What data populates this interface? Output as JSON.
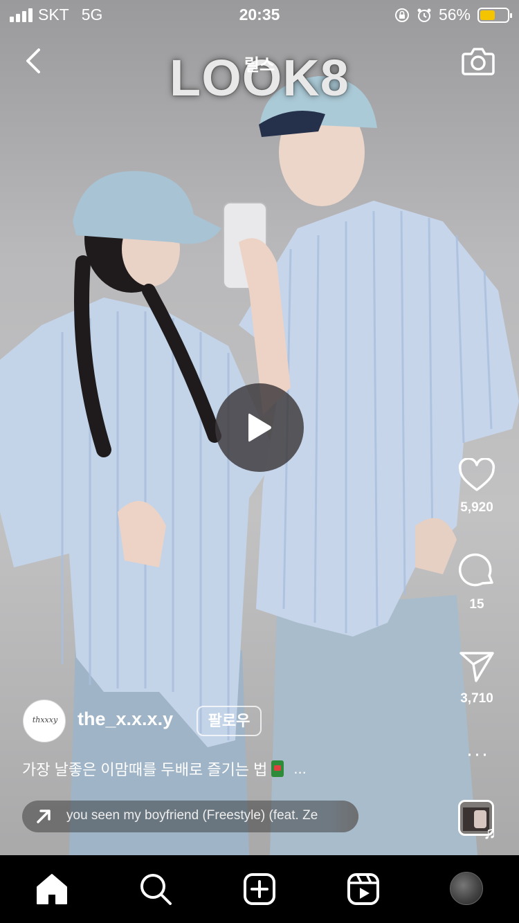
{
  "status_bar": {
    "carrier": "SKT",
    "network": "5G",
    "time": "20:35",
    "battery_percent": "56%",
    "battery_level": 0.56,
    "battery_color": "#f5c400"
  },
  "header": {
    "title": "릴스",
    "back_icon": "chevron-left-icon",
    "camera_icon": "camera-icon"
  },
  "video": {
    "brand_watermark": "LOOK8",
    "play_icon": "play-icon"
  },
  "actions": {
    "like_count": "5,920",
    "comment_count": "15",
    "share_count": "3,710",
    "more_label": "···"
  },
  "post": {
    "avatar_text": "thxxxy",
    "username": "the_x.x.x.y",
    "follow_label": "팔로우",
    "caption": "가장 날좋은 이맘때를 두배로 즐기는 법",
    "caption_more": "...",
    "audio_track": "you seen my boyfriend (Freestyle) (feat. Ze"
  },
  "tab_bar": {
    "items": [
      "home-icon",
      "search-icon",
      "add-icon",
      "reels-icon",
      "profile-avatar"
    ]
  }
}
